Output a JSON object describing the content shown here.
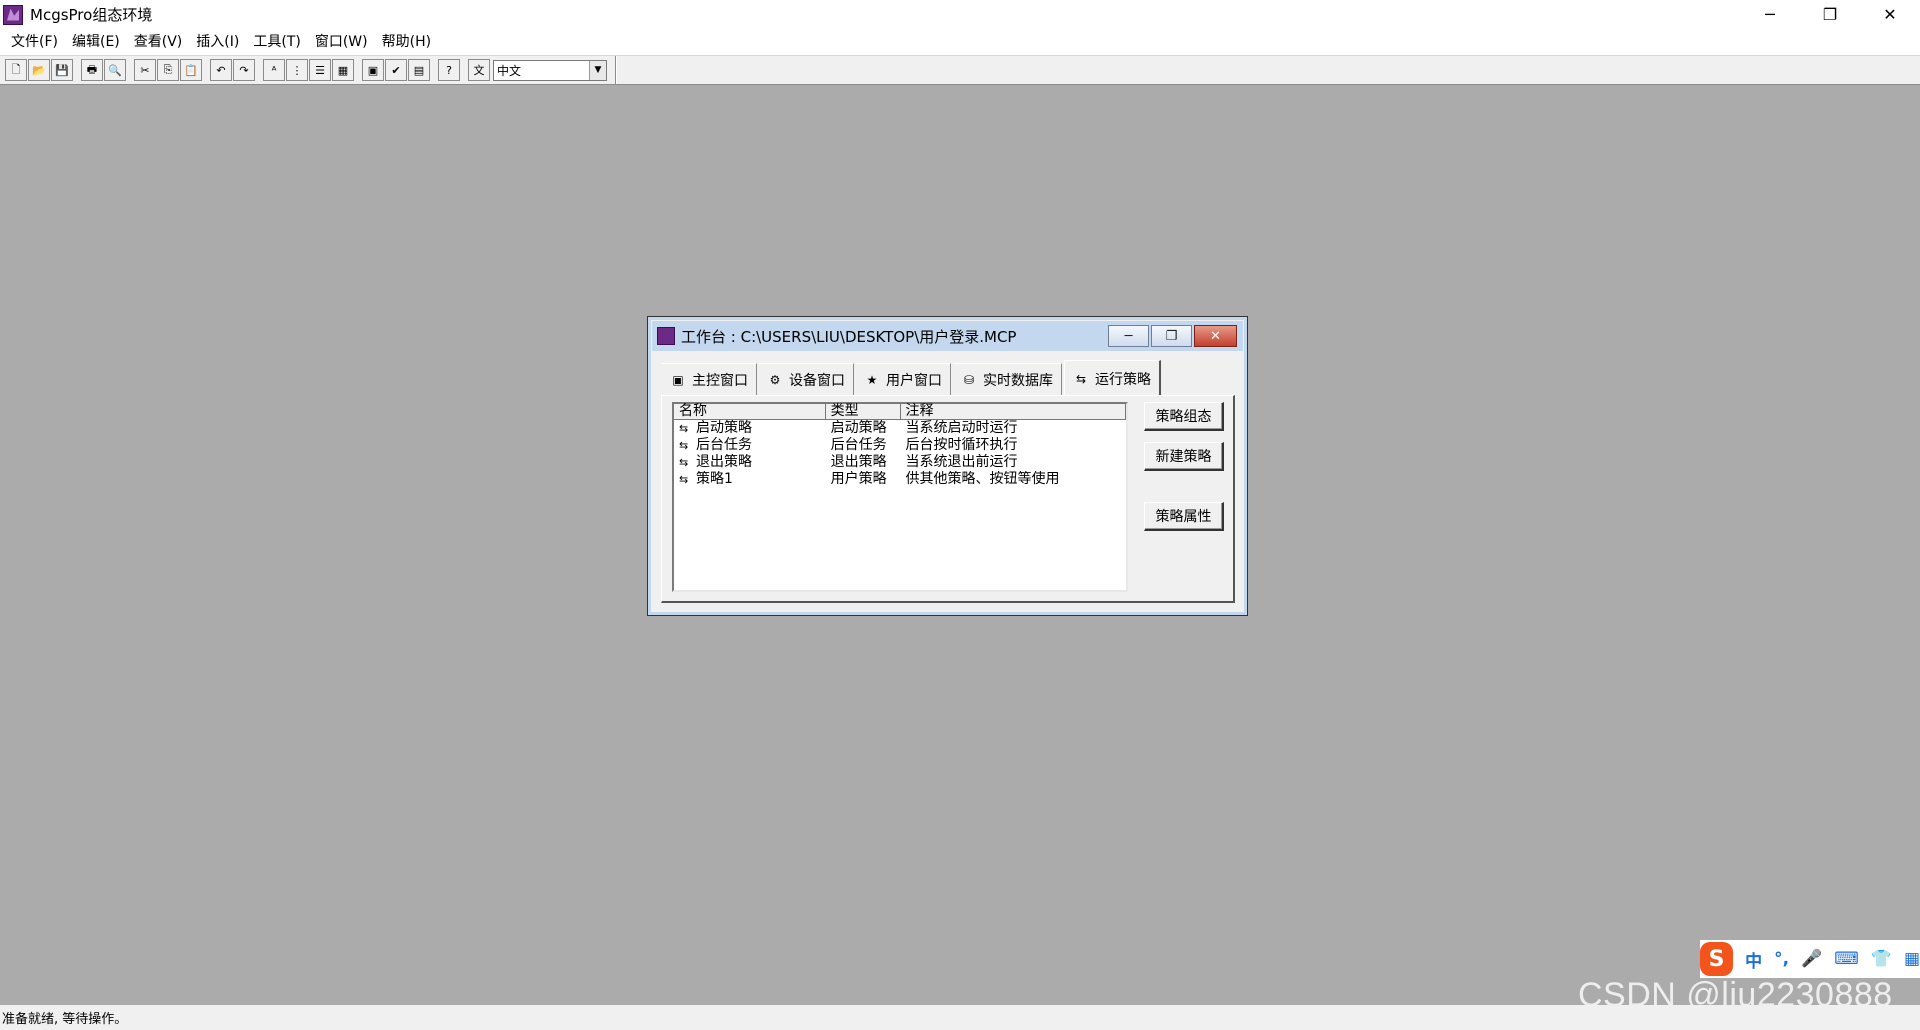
{
  "app": {
    "title": "McgsPro组态环境"
  },
  "window_controls": {
    "minimize": "─",
    "restore": "❐",
    "close": "✕"
  },
  "menu": [
    "文件(F)",
    "编辑(E)",
    "查看(V)",
    "插入(I)",
    "工具(T)",
    "窗口(W)",
    "帮助(H)"
  ],
  "toolbar": {
    "language_value": "中文",
    "groups": [
      [
        "new-file-icon",
        "open-folder-icon",
        "save-icon"
      ],
      [
        "print-icon",
        "print-preview-icon"
      ],
      [
        "cut-icon",
        "copy-icon",
        "paste-icon"
      ],
      [
        "undo-icon",
        "redo-icon"
      ],
      [
        "text-icon",
        "align-icon",
        "list-icon",
        "grid-icon"
      ],
      [
        "properties-icon",
        "check-icon",
        "compile-icon"
      ],
      [
        "help-icon"
      ],
      [
        "language-icon"
      ]
    ],
    "glyphs": [
      "🗋",
      "📂",
      "💾",
      "🖶",
      "🔍",
      "✂",
      "⎘",
      "📋",
      "↶",
      "↷",
      "ᴬ",
      "⋮",
      "☰",
      "▦",
      "▣",
      "✔",
      "▤",
      "?",
      "文"
    ]
  },
  "workbench": {
    "title": "工作台 : C:\\USERS\\LIU\\DESKTOP\\用户登录.MCP",
    "tabs": [
      {
        "label": "主控窗口",
        "icon": "main-window-icon",
        "glyph": "▣"
      },
      {
        "label": "设备窗口",
        "icon": "device-window-icon",
        "glyph": "⚙"
      },
      {
        "label": "用户窗口",
        "icon": "user-window-icon",
        "glyph": "★"
      },
      {
        "label": "实时数据库",
        "icon": "realtime-database-icon",
        "glyph": "⛁"
      },
      {
        "label": "运行策略",
        "icon": "strategy-icon",
        "glyph": "⇆"
      }
    ],
    "columns": [
      "名称",
      "类型",
      "注释"
    ],
    "rows": [
      {
        "name": "启动策略",
        "type": "启动策略",
        "note": "当系统启动时运行"
      },
      {
        "name": "后台任务",
        "type": "后台任务",
        "note": "后台按时循环执行"
      },
      {
        "name": "退出策略",
        "type": "退出策略",
        "note": "当系统退出前运行"
      },
      {
        "name": "策略1",
        "type": "用户策略",
        "note": "供其他策略、按钮等使用"
      }
    ],
    "row_glyph": "⇆",
    "buttons": {
      "configure": "策略组态",
      "new": "新建策略",
      "properties": "策略属性"
    }
  },
  "status": {
    "text": "准备就绪, 等待操作。"
  },
  "ime": {
    "logo": "S",
    "items": [
      "中",
      "°,",
      "🎤",
      "⌨",
      "👕",
      "▦"
    ]
  },
  "watermark": "CSDN @liu2230888"
}
